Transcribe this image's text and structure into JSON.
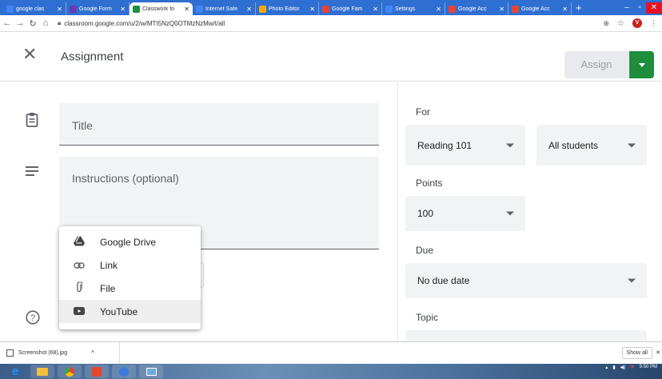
{
  "browser": {
    "tabs": [
      {
        "title": "google clas",
        "color": "#4285f4"
      },
      {
        "title": "Google Form",
        "color": "#673ab7"
      },
      {
        "title": "Classwork fo",
        "color": "#1e8e3e",
        "active": true
      },
      {
        "title": "Internet Safe",
        "color": "#4285f4"
      },
      {
        "title": "Photo Editor",
        "color": "#f9ab00"
      },
      {
        "title": "Google Fam",
        "color": "#ea4335"
      },
      {
        "title": "Settings",
        "color": "#4285f4"
      },
      {
        "title": "Google Acc",
        "color": "#ea4335"
      },
      {
        "title": "Google Acc",
        "color": "#ea4335"
      }
    ],
    "new_tab": "+",
    "url": "classroom.google.com/u/2/w/MTI5NzQ0OTMzNzMw/t/all",
    "avatar": "V"
  },
  "appbar": {
    "title": "Assignment",
    "assign_label": "Assign",
    "accent": "#1e8e3e"
  },
  "form": {
    "title_placeholder": "Title",
    "instructions_placeholder": "Instructions (optional)"
  },
  "add_menu": {
    "items": [
      {
        "label": "Google Drive",
        "icon": "google-drive-icon"
      },
      {
        "label": "Link",
        "icon": "link-icon"
      },
      {
        "label": "File",
        "icon": "paperclip-icon"
      },
      {
        "label": "YouTube",
        "icon": "youtube-icon"
      }
    ]
  },
  "settings": {
    "for_label": "For",
    "class_value": "Reading 101",
    "students_value": "All students",
    "points_label": "Points",
    "points_value": "100",
    "due_label": "Due",
    "due_value": "No due date",
    "topic_label": "Topic"
  },
  "downloads": {
    "file": "Screenshot (68).jpg",
    "show_all": "Show all"
  },
  "taskbar": {
    "time": "9:50 PM"
  }
}
